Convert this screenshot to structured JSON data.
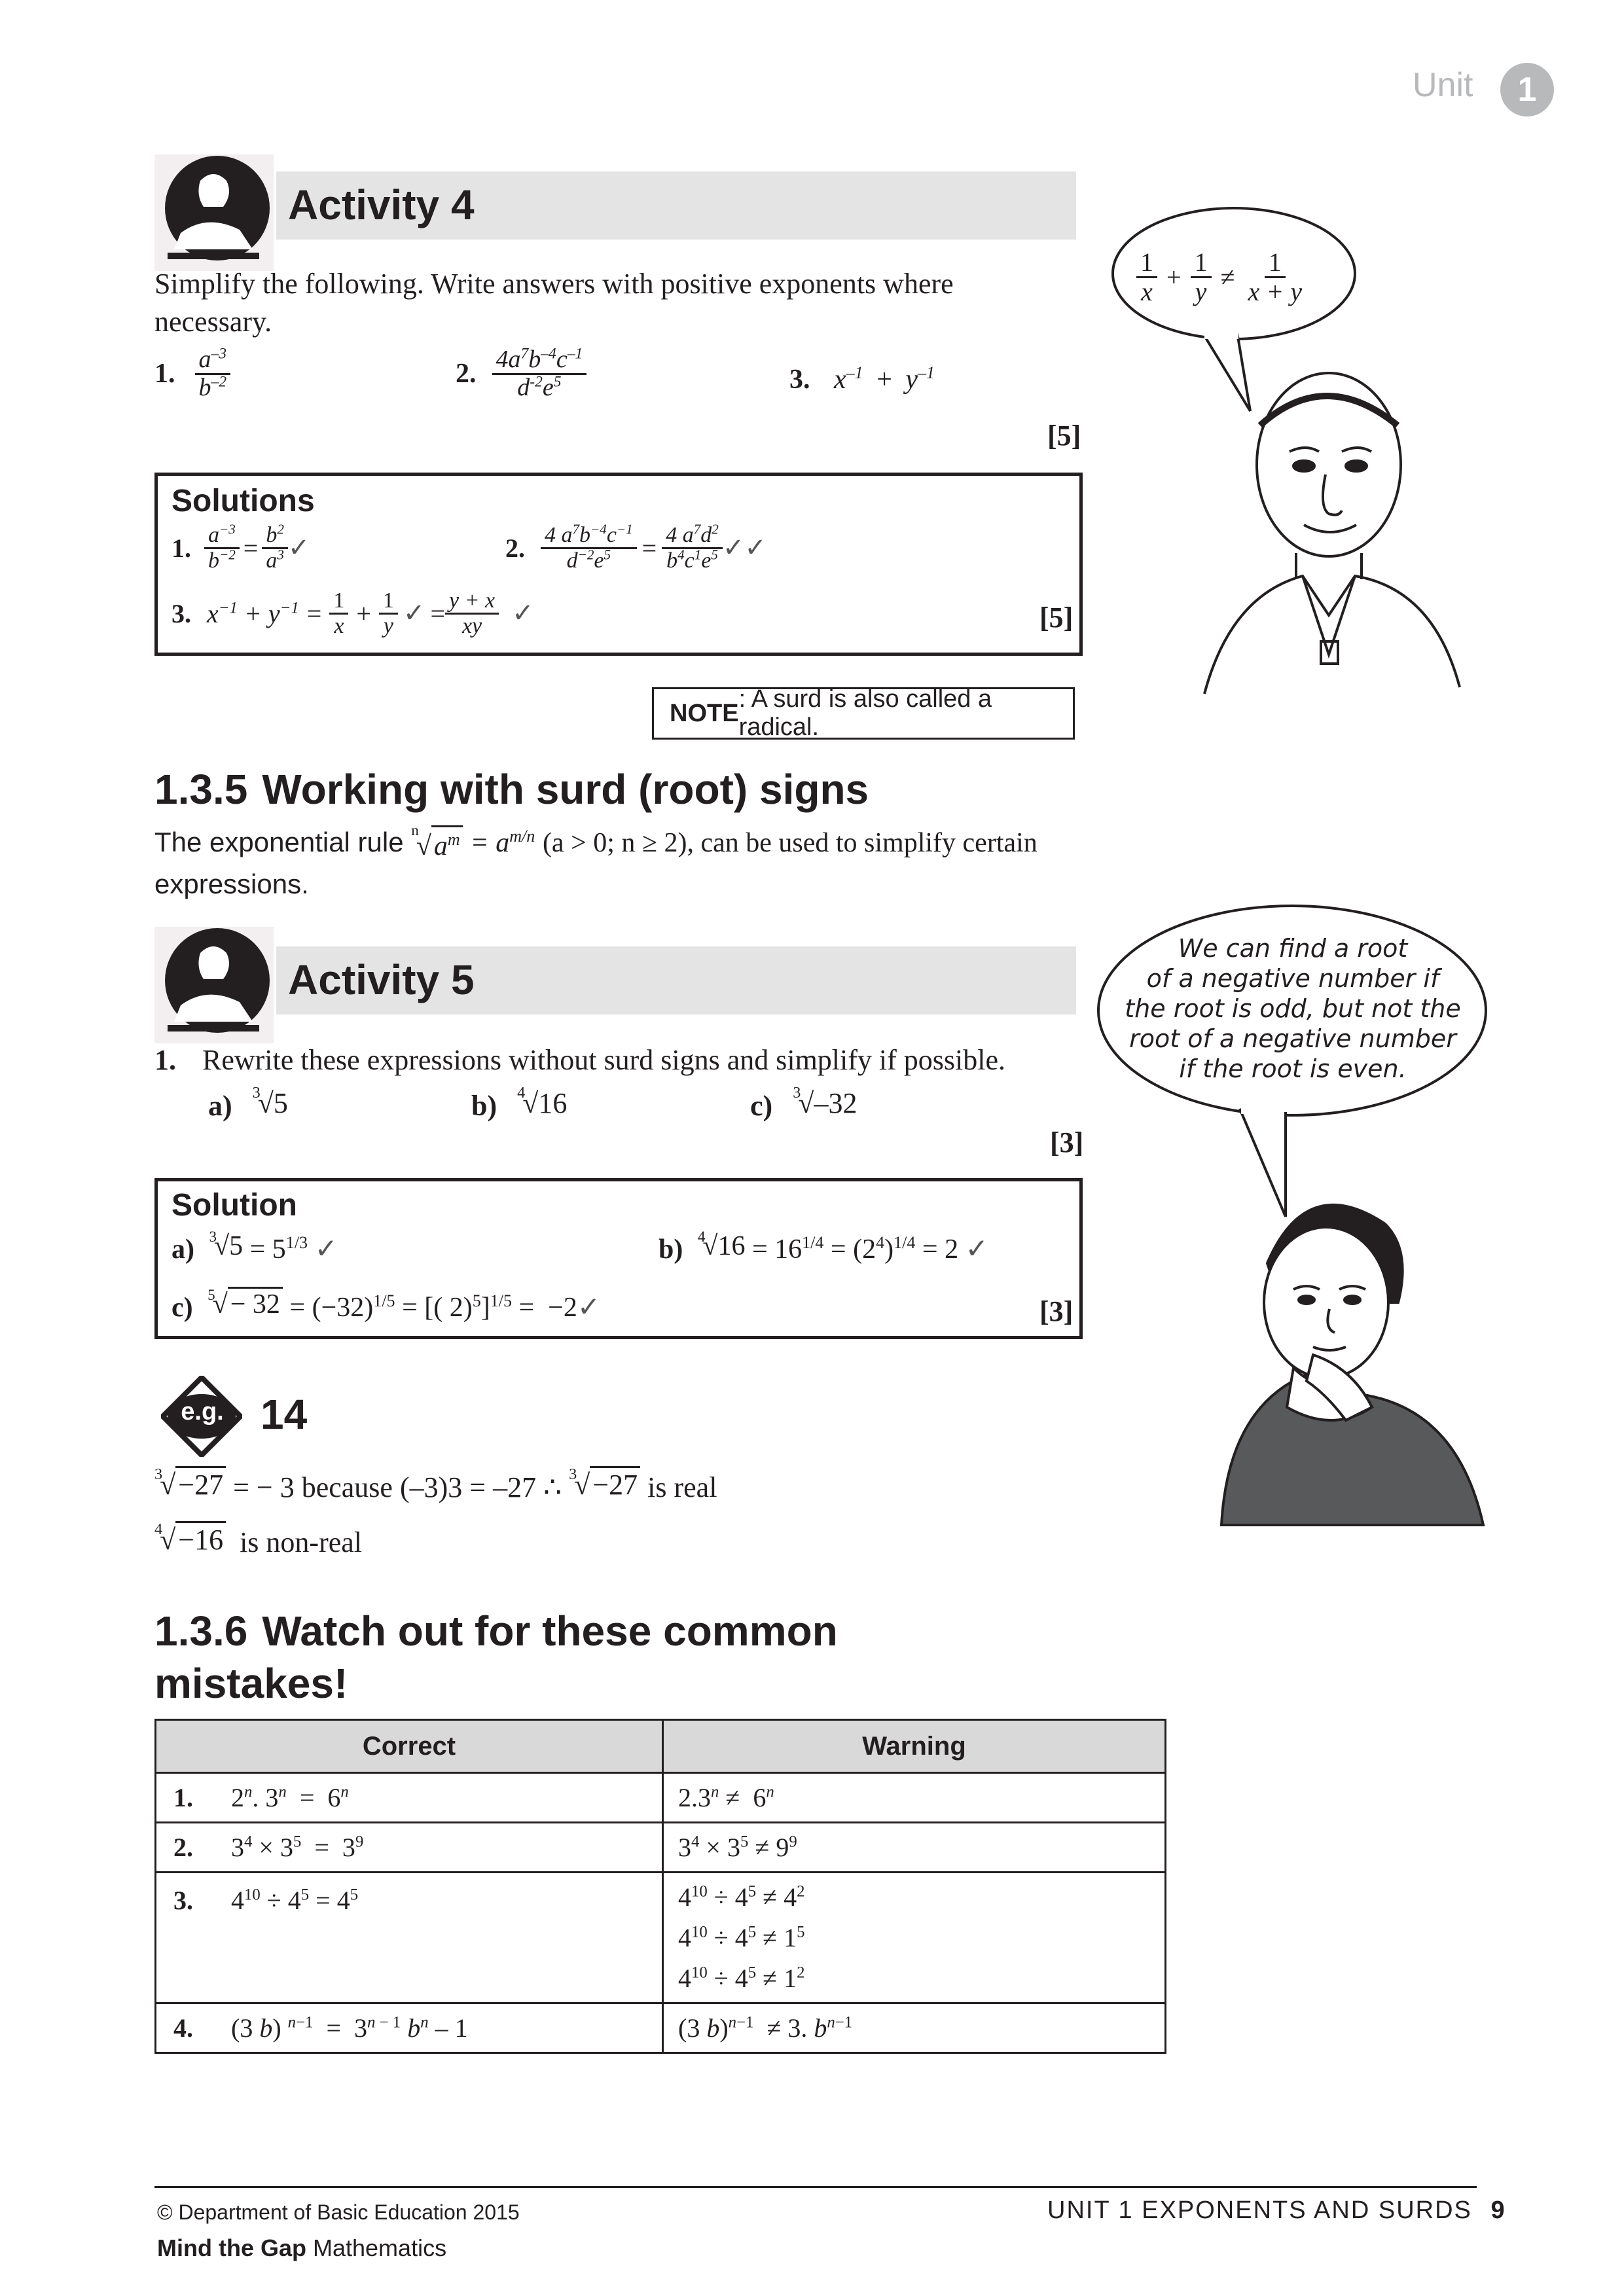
{
  "header": {
    "unit_label": "Unit",
    "unit_number": "1"
  },
  "activity4": {
    "title": "Activity 4",
    "instruction": "Simplify the following. Write answers with positive exponents where necessary.",
    "questions": [
      {
        "number": "1.",
        "num": "a",
        "num_exp": "–3",
        "den": "b",
        "den_exp": "–2"
      },
      {
        "number": "2.",
        "num": "4a",
        "num_exp_a": "7",
        "num_b": "b",
        "num_exp_b": "–4",
        "num_c": "c",
        "num_exp_c": "–1",
        "den_d": "d",
        "den_exp_d": "-2",
        "den_e": "e",
        "den_exp_e": "5"
      },
      {
        "number": "3.",
        "x": "x",
        "x_exp": "–1",
        "plus": "+",
        "y": "y",
        "y_exp": "–1"
      }
    ],
    "marks": "[5]"
  },
  "solutions4": {
    "heading": "Solutions",
    "s1_number": "1.",
    "s2_number": "2.",
    "s3_number": "3.",
    "marks": "[5]",
    "tick": "✓",
    "double_tick": "✓✓"
  },
  "note": {
    "label": "NOTE",
    "text": ": A surd is also called a radical."
  },
  "section135": {
    "number": "1.3.5",
    "title": "Working with surd (root) signs",
    "text_before": "The exponential rule",
    "text_after": "(a > 0; n ≥ 2), can be used to simplify certain",
    "text_line2": "expressions."
  },
  "activity5": {
    "title": "Activity 5",
    "q_number": "1.",
    "instruction": "Rewrite these expressions without surd signs and simplify if possible.",
    "parts": [
      {
        "label": "a)",
        "index": "3",
        "radicand": "5"
      },
      {
        "label": "b)",
        "index": "4",
        "radicand": "16"
      },
      {
        "label": "c)",
        "index": "3",
        "radicand": "–32"
      }
    ],
    "marks": "[3]"
  },
  "solution5": {
    "heading": "Solution",
    "a_label": "a)",
    "b_label": "b)",
    "c_label": "c)",
    "marks": "[3]"
  },
  "example14": {
    "badge": "e.g.",
    "number": "14",
    "line1_mid": "= − 3 because (–3)3 = –27 ∴",
    "line1_end": "is real",
    "line2_end": "is non-real"
  },
  "section136": {
    "number": "1.3.6",
    "title_line1": "Watch out for these common",
    "title_line2": "mistakes!"
  },
  "mistakes_table": {
    "headers": [
      "Correct",
      "Warning"
    ],
    "row_numbers": [
      "1.",
      "2.",
      "3.",
      "4."
    ]
  },
  "speech1": {
    "text": "1/x + 1/y ≠ 1/(x + y)"
  },
  "speech2": {
    "lines": [
      "We can find a root",
      "of a negative number if",
      "the root is odd, but not the",
      "root of a negative number",
      "if the root is even."
    ]
  },
  "footer": {
    "copyright": "© Department of Basic Education 2015",
    "book_bold": "Mind the Gap",
    "book_rest": " Mathematics",
    "unit_text": "UNIT 1 EXPONENTS AND SURDS",
    "page": "9"
  }
}
